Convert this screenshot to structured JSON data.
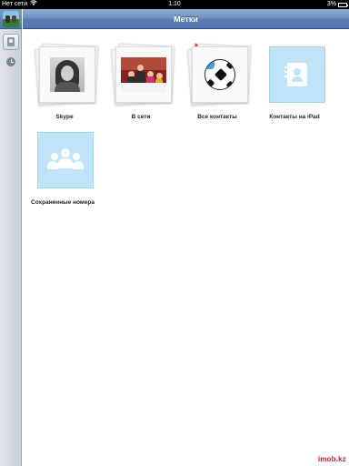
{
  "status_bar": {
    "carrier": "Нет сети",
    "time": "1:10",
    "battery": "3%",
    "wifi_icon": "wifi-icon"
  },
  "sidebar": {
    "items": [
      {
        "icon": "contacts-icon",
        "active": true
      },
      {
        "icon": "clock-icon",
        "active": false
      }
    ]
  },
  "navbar": {
    "title": "Метки"
  },
  "tiles": [
    {
      "label": "Skype"
    },
    {
      "label": "В сети"
    },
    {
      "label": "Все контакты"
    },
    {
      "label": "Контакты на iPad"
    },
    {
      "label": "Сохраненные номера"
    }
  ],
  "watermark": "imob.kz",
  "colors": {
    "navbar": "#5b7db4",
    "tile_icon_bg": "#bfe3f7",
    "watermark": "#d11a2a"
  }
}
